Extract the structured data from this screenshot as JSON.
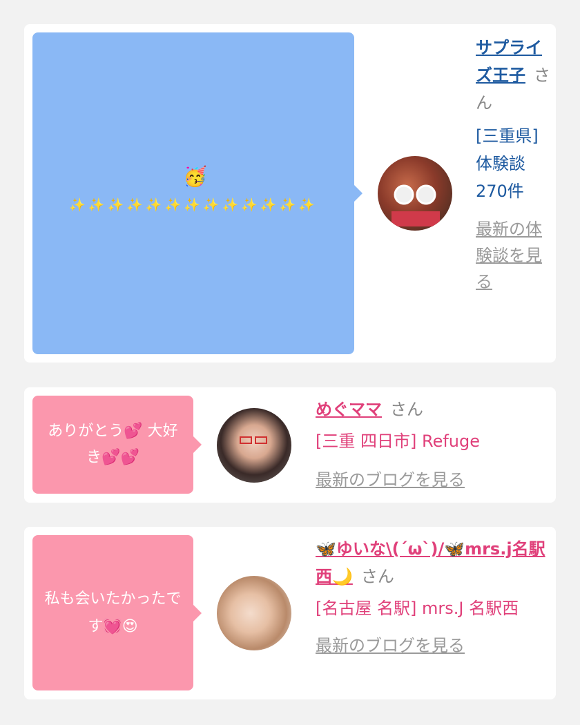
{
  "cards": [
    {
      "message_top_emoji": "🥳",
      "message": "✨✨✨✨✨✨✨✨✨✨✨✨✨",
      "bubble_color": "#8ab8f5",
      "name": "サプライズ王子",
      "honorific": "さん",
      "location": "[三重県] 体験談 270件",
      "link": "最新の体験談を見る",
      "accent": "#1e5aa0"
    },
    {
      "message": "ありがとう💕 大好き💕💕",
      "bubble_color": "#fb97ad",
      "name": "めぐママ",
      "honorific": "さん",
      "location": "[三重 四日市] Refuge",
      "link": "最新のブログを見る",
      "accent": "#e0407a"
    },
    {
      "message": "私も会いたかったです💓😍",
      "bubble_color": "#fb97ad",
      "name": "🦋ゆいな\\(´ω`)/🦋mrs.j名駅西🌙",
      "honorific": "さん",
      "location": "[名古屋 名駅] mrs.J 名駅西",
      "link": "最新のブログを見る",
      "accent": "#e0407a"
    }
  ]
}
